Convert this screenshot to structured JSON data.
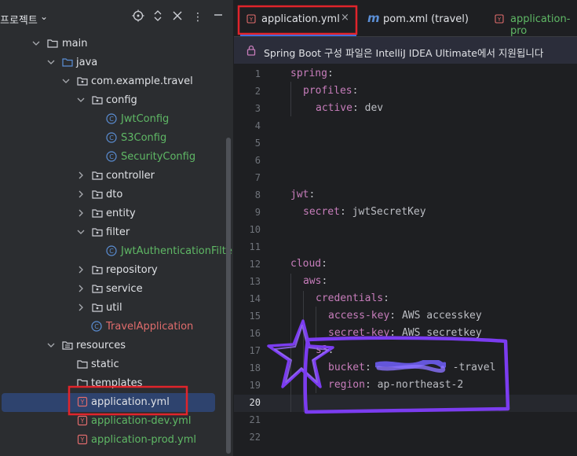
{
  "project_panel": {
    "title": "프로젝트",
    "tree": [
      {
        "label": "main",
        "type": "folder",
        "depth": 2,
        "expanded": true
      },
      {
        "label": "java",
        "type": "source-folder",
        "depth": 3,
        "expanded": true
      },
      {
        "label": "com.example.travel",
        "type": "package",
        "depth": 4,
        "expanded": true
      },
      {
        "label": "config",
        "type": "package",
        "depth": 5,
        "expanded": true
      },
      {
        "label": "JwtConfig",
        "type": "class",
        "depth": 6
      },
      {
        "label": "S3Config",
        "type": "class",
        "depth": 6
      },
      {
        "label": "SecurityConfig",
        "type": "class",
        "depth": 6
      },
      {
        "label": "controller",
        "type": "package",
        "depth": 5,
        "expanded": false
      },
      {
        "label": "dto",
        "type": "package",
        "depth": 5,
        "expanded": false
      },
      {
        "label": "entity",
        "type": "package",
        "depth": 5,
        "expanded": false
      },
      {
        "label": "filter",
        "type": "package",
        "depth": 5,
        "expanded": true
      },
      {
        "label": "JwtAuthenticationFilte",
        "type": "class",
        "depth": 6
      },
      {
        "label": "repository",
        "type": "package",
        "depth": 5,
        "expanded": false
      },
      {
        "label": "service",
        "type": "package",
        "depth": 5,
        "expanded": false
      },
      {
        "label": "util",
        "type": "package",
        "depth": 5,
        "expanded": false
      },
      {
        "label": "TravelApplication",
        "type": "app-class",
        "depth": 5
      },
      {
        "label": "resources",
        "type": "resources-folder",
        "depth": 3,
        "expanded": true
      },
      {
        "label": "static",
        "type": "folder",
        "depth": 4
      },
      {
        "label": "templates",
        "type": "folder",
        "depth": 4
      },
      {
        "label": "application.yml",
        "type": "yaml",
        "depth": 4,
        "selected": true
      },
      {
        "label": "application-dev.yml",
        "type": "yaml",
        "depth": 4
      },
      {
        "label": "application-prod.yml",
        "type": "yaml",
        "depth": 4
      }
    ]
  },
  "tabs": [
    {
      "label": "application.yml",
      "active": true,
      "icon": "yaml-icon"
    },
    {
      "label": "pom.xml (travel)",
      "active": false,
      "icon": "maven-icon"
    },
    {
      "label": "application-pro",
      "active": false,
      "icon": "yaml-icon"
    }
  ],
  "banner": {
    "text": "Spring Boot 구성 파일은 IntelliJ IDEA Ultimate에서 지원됩니다"
  },
  "editor": {
    "current_line": 20,
    "lines": [
      {
        "n": "1",
        "indent": 0,
        "key": "spring",
        "value": ""
      },
      {
        "n": "2",
        "indent": 1,
        "key": "profiles",
        "value": ""
      },
      {
        "n": "3",
        "indent": 2,
        "key": "active",
        "value": "dev"
      },
      {
        "n": "4",
        "indent": 0,
        "key": "",
        "value": ""
      },
      {
        "n": "5",
        "indent": 0,
        "key": "",
        "value": ""
      },
      {
        "n": "6",
        "indent": 0,
        "key": "",
        "value": ""
      },
      {
        "n": "7",
        "indent": 0,
        "key": "",
        "value": ""
      },
      {
        "n": "8",
        "indent": 0,
        "key": "jwt",
        "value": ""
      },
      {
        "n": "9",
        "indent": 1,
        "key": "secret",
        "value": "jwtSecretKey"
      },
      {
        "n": "10",
        "indent": 0,
        "key": "",
        "value": ""
      },
      {
        "n": "11",
        "indent": 0,
        "key": "",
        "value": ""
      },
      {
        "n": "12",
        "indent": 0,
        "key": "cloud",
        "value": ""
      },
      {
        "n": "13",
        "indent": 1,
        "key": "aws",
        "value": ""
      },
      {
        "n": "14",
        "indent": 2,
        "key": "credentials",
        "value": ""
      },
      {
        "n": "15",
        "indent": 3,
        "key": "access-key",
        "value": "AWS accesskey"
      },
      {
        "n": "16",
        "indent": 3,
        "key": "secret-key",
        "value": "AWS secretkey"
      },
      {
        "n": "17",
        "indent": 2,
        "key": "s3",
        "value": ""
      },
      {
        "n": "18",
        "indent": 3,
        "key": "bucket",
        "value": "-travel"
      },
      {
        "n": "19",
        "indent": 3,
        "key": "region",
        "value": "ap-northeast-2"
      },
      {
        "n": "20",
        "indent": 0,
        "key": "",
        "value": ""
      },
      {
        "n": "21",
        "indent": 0,
        "key": "",
        "value": ""
      },
      {
        "n": "22",
        "indent": 0,
        "key": "",
        "value": ""
      }
    ]
  },
  "colors": {
    "highlight_red": "#e0242b",
    "annotation_purple": "#7b3cf0"
  }
}
